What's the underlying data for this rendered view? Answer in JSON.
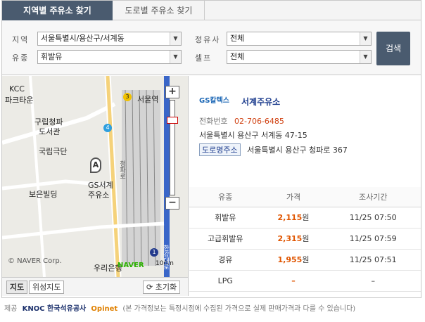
{
  "tabs": [
    {
      "label": "지역별 주유소 찾기"
    },
    {
      "label": "도로별 주유소 찾기"
    }
  ],
  "search": {
    "region_label": "지역",
    "region_value": "서울특별시/용산구/서계동",
    "fuel_label": "유종",
    "fuel_value": "휘발유",
    "brand_label": "정유사",
    "brand_value": "전체",
    "self_label": "셀프",
    "self_value": "전체",
    "search_button": "검색"
  },
  "map": {
    "labels": {
      "kcc": "KCC",
      "parktown": "파크타운",
      "library_1": "구립청파",
      "library_2": "도서관",
      "theater": "국립극단",
      "gs_1": "GS서계",
      "gs_2": "주유소",
      "boeun": "보은빌딩",
      "seoul_station": "서울역",
      "urieun": "우리은행",
      "copyright": "© NAVER Corp.",
      "naver": "NAVER",
      "road_1": "청파로",
      "road_2": "한강대로",
      "marker": "A",
      "subway_3": "3",
      "subway_4": "4",
      "subway_1": "1",
      "scale": "100m"
    },
    "zoom_in": "+",
    "zoom_out": "−",
    "map_button": "지도",
    "satellite_button": "위성지도",
    "reset_button": "초기화",
    "reset_icon": "refresh-icon"
  },
  "station": {
    "brand": "GS칼텍스",
    "name": "서계주유소",
    "phone_label": "전화번호",
    "phone": "02-706-6485",
    "address": "서울특별시 용산구 서계동 47-15",
    "road_badge": "도로명주소",
    "road_address": "서울특별시 용산구 청파로 367"
  },
  "prices": {
    "headers": [
      "유종",
      "가격",
      "조사기간"
    ],
    "unit": "원",
    "rows": [
      {
        "fuel": "휘발유",
        "price": "2,115",
        "date": "11/25 07:50"
      },
      {
        "fuel": "고급휘발유",
        "price": "2,315",
        "date": "11/25 07:59"
      },
      {
        "fuel": "경유",
        "price": "1,955",
        "date": "11/25 07:51"
      },
      {
        "fuel": "LPG",
        "price": "–",
        "date": "–"
      }
    ]
  },
  "footer": {
    "prefix": "제공",
    "knoc": "KNOC 한국석유공사",
    "opinet": "Opinet",
    "note": "(본 가격정보는 특정시점에 수집된 가격으로 실제 판매가격과 다를 수 있습니다)"
  },
  "colors": {
    "tab_active": "#4a5b6f",
    "price": "#e05500",
    "station_name": "#1a3a8c"
  }
}
